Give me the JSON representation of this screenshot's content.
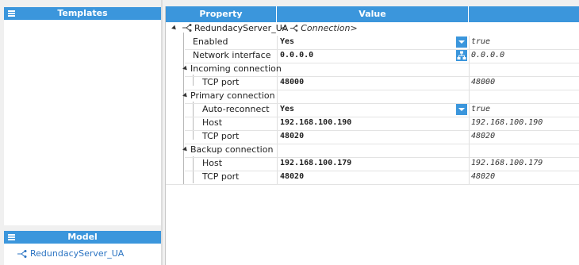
{
  "templates_panel": {
    "title": "Templates"
  },
  "model_panel": {
    "title": "Model",
    "items": [
      {
        "label": "RedundacyServer_UA"
      }
    ]
  },
  "property_grid": {
    "columns": [
      "Property",
      "Value",
      ""
    ],
    "root": {
      "label": "RedundacyServer_UA",
      "value": "<",
      "type": "Connection>"
    },
    "rows": [
      {
        "label": "Enabled",
        "value": "Yes",
        "default": "true"
      },
      {
        "label": "Network interface",
        "value": "0.0.0.0",
        "default": "0.0.0.0"
      },
      {
        "label": "Incoming connection"
      },
      {
        "label": "TCP port",
        "value": "48000",
        "default": "48000"
      },
      {
        "label": "Primary connection"
      },
      {
        "label": "Auto-reconnect",
        "value": "Yes",
        "default": "true"
      },
      {
        "label": "Host",
        "value": "192.168.100.190",
        "default": "192.168.100.190"
      },
      {
        "label": "TCP port",
        "value": "48020",
        "default": "48020"
      },
      {
        "label": "Backup connection"
      },
      {
        "label": "Host",
        "value": "192.168.100.179",
        "default": "192.168.100.179"
      },
      {
        "label": "TCP port",
        "value": "48020",
        "default": "48020"
      }
    ]
  },
  "colors": {
    "header": "#3b96dc",
    "link": "#2a73c2"
  }
}
